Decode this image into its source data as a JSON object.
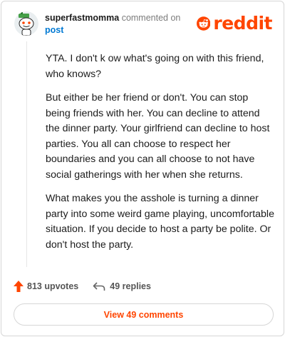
{
  "header": {
    "username": "superfastmomma",
    "verb": "commented on",
    "target": "post",
    "logo_text": "reddit"
  },
  "comment": {
    "paragraphs": [
      "YTA. I don't k ow what's going on with this friend, who knows?",
      "But either be her friend or don't. You can stop being friends with her. You can decline to attend the dinner party. Your girlfriend can decline to host parties. You all can choose to respect her boundaries and you can all choose to not have social gatherings with her when she returns.",
      "What makes you the asshole is turning a dinner party into some weird game playing, uncomfortable situation. If you decide to host a party be polite. Or don't host the party."
    ]
  },
  "footer": {
    "upvotes_label": "813 upvotes",
    "replies_label": "49 replies",
    "view_comments_label": "View 49 comments"
  },
  "colors": {
    "accent": "#ff4500",
    "link": "#0079d3",
    "text": "#1c1c1c",
    "muted": "#7c7c7c",
    "border": "#d6d6d6"
  },
  "icons": [
    "avatar",
    "reddit-logo-icon",
    "upvote-arrow-icon",
    "reply-arrow-icon"
  ]
}
